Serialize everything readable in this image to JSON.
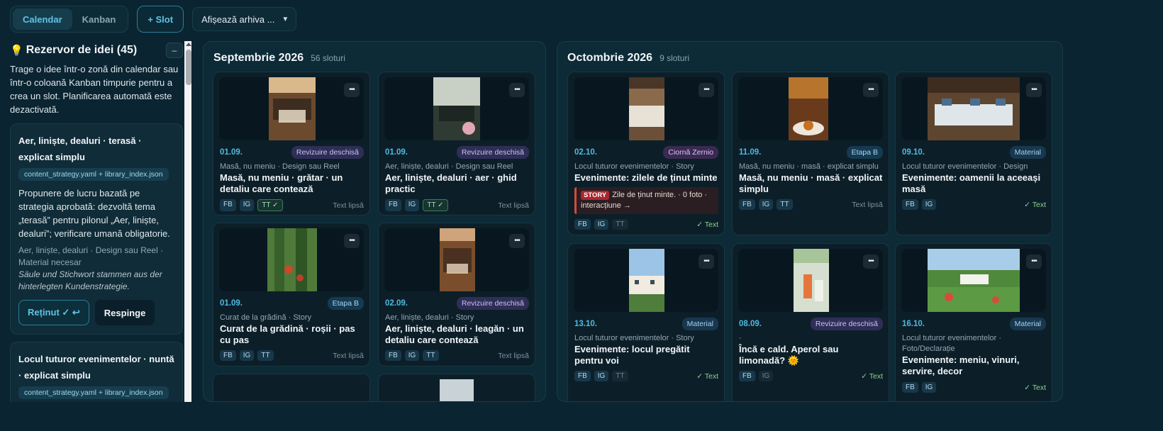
{
  "toolbar": {
    "view_calendar": "Calendar",
    "view_kanban": "Kanban",
    "slot_button": "+ Slot",
    "archive_select": "Afișează arhiva ..."
  },
  "pool": {
    "title": "Rezervor de idei (45)",
    "collapse": "–",
    "description": "Trage o idee într-o zonă din calendar sau într-o coloană Kanban timpurie pentru a crea un slot. Planificarea automată este dezactivată.",
    "ideas": [
      {
        "title": "Aer, liniște, dealuri · terasă · explicat simplu",
        "source": "content_strategy.yaml + library_index.json",
        "body": "Propunere de lucru bazată pe strategia aprobată: dezvoltă tema „terasă” pentru pilonul „Aer, liniște, dealuri”; verificare umană obligatorie.",
        "meta": "Aer, liniște, dealuri · Design sau Reel · Material necesar",
        "note": "Säule und Stichwort stammen aus der hinterlegten Kundenstrategie.",
        "keep": "Reținut ✓ ↩",
        "reject": "Respinge"
      },
      {
        "title": "Locul tuturor evenimentelor · nuntă · explicat simplu",
        "source": "content_strategy.yaml + library_index.json"
      }
    ]
  },
  "months": [
    {
      "title": "Septembrie 2026",
      "count": "56 sloturi",
      "slots": [
        {
          "date": "01.09.",
          "badge": "Revizuire deschisă",
          "meta": "Masă, nu meniu · Design sau Reel",
          "title": "Masă, nu meniu · grătar · un detaliu care contează",
          "chips": [
            "FB",
            "IG",
            "TT ✓"
          ],
          "status": "Text lipsă"
        },
        {
          "date": "01.09.",
          "badge": "Revizuire deschisă",
          "meta": "Aer, liniște, dealuri · Design sau Reel",
          "title": "Aer, liniște, dealuri · aer · ghid practic",
          "chips": [
            "FB",
            "IG",
            "TT ✓"
          ],
          "status": "Text lipsă"
        },
        {
          "date": "01.09.",
          "badge": "Etapa B",
          "meta": "Curat de la grădină · Story",
          "title": "Curat de la grădină · roșii · pas cu pas",
          "chips": [
            "FB",
            "IG",
            "TT"
          ],
          "status": "Text lipsă"
        },
        {
          "date": "02.09.",
          "badge": "Revizuire deschisă",
          "meta": "Aer, liniște, dealuri · Story",
          "title": "Aer, liniște, dealuri · leagăn · un detaliu care contează",
          "chips": [
            "FB",
            "IG",
            "TT"
          ],
          "status": "Text lipsă"
        }
      ]
    },
    {
      "title": "Octombrie 2026",
      "count": "9 sloturi",
      "slots": [
        {
          "date": "02.10.",
          "badge": "Ciornă Zernio",
          "meta": "Locul tuturor evenimentelor · Story",
          "title": "Evenimente: zilele de ținut minte",
          "story_tag": "STORY",
          "story_text": "Zile de ținut minte. · 0 foto · interacțiune →",
          "chips": [
            "FB",
            "IG",
            "TT"
          ],
          "status": "✓ Text"
        },
        {
          "date": "11.09.",
          "badge": "Etapa B",
          "meta": "Masă, nu meniu · masă · explicat simplu",
          "title": "Masă, nu meniu · masă · explicat simplu",
          "chips": [
            "FB",
            "IG",
            "TT"
          ],
          "status": "Text lipsă"
        },
        {
          "date": "09.10.",
          "badge": "Material",
          "meta": "Locul tuturor evenimentelor · Design",
          "title": "Evenimente: oamenii la aceeași masă",
          "chips": [
            "FB",
            "IG"
          ],
          "status": "✓ Text"
        },
        {
          "date": "13.10.",
          "badge": "Material",
          "meta": "Locul tuturor evenimentelor · Story",
          "title": "Evenimente: locul pregătit pentru voi",
          "chips": [
            "FB",
            "IG",
            "TT"
          ],
          "status": "✓ Text"
        },
        {
          "date": "08.09.",
          "badge": "Revizuire deschisă",
          "meta": "·",
          "title": "Încă e cald. Aperol sau limonadă? 🌞",
          "chips": [
            "FB",
            "IG"
          ],
          "status": "✓ Text"
        },
        {
          "date": "16.10.",
          "badge": "Material",
          "meta": "Locul tuturor evenimentelor · Foto/Declarație",
          "title": "Evenimente: meniu, vinuri, servire, decor",
          "chips": [
            "FB",
            "IG"
          ],
          "status": "✓ Text"
        }
      ]
    }
  ],
  "colors": {
    "accent": "#5fc3e4",
    "background": "#0a2431",
    "panel": "#0d2a37",
    "date": "#4fb9e0",
    "ok": "#8bd48f"
  }
}
